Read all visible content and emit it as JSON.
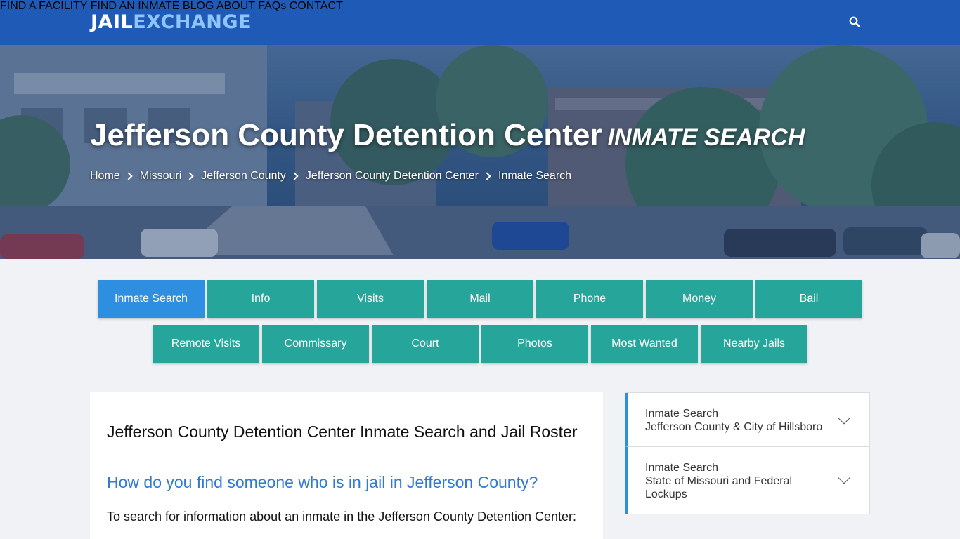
{
  "header": {
    "logo_part1": "JAIL",
    "logo_part2": "EXCHANGE",
    "nav": [
      "FIND A FACILITY",
      "FIND AN INMATE",
      "BLOG",
      "ABOUT",
      "FAQs",
      "CONTACT"
    ],
    "search_icon": "search-icon"
  },
  "hero": {
    "title": "Jefferson County Detention Center",
    "title_sub": "INMATE SEARCH",
    "breadcrumbs": [
      "Home",
      "Missouri",
      "Jefferson County",
      "Jefferson County Detention Center",
      "Inmate Search"
    ]
  },
  "tabs": {
    "row1": [
      "Inmate Search",
      "Info",
      "Visits",
      "Mail",
      "Phone",
      "Money",
      "Bail"
    ],
    "row2": [
      "Remote Visits",
      "Commissary",
      "Court",
      "Photos",
      "Most Wanted",
      "Nearby Jails"
    ],
    "active": "Inmate Search"
  },
  "main": {
    "heading": "Jefferson County Detention Center Inmate Search and Jail Roster",
    "subheading": "How do you find someone who is in jail in Jefferson County?",
    "intro": "To search for information about an inmate in the Jefferson County Detention Center:"
  },
  "sidebar": {
    "items": [
      {
        "line1": "Inmate Search",
        "line2": "Jefferson County & City of Hillsboro"
      },
      {
        "line1": "Inmate Search",
        "line2": "State of Missouri and Federal Lockups"
      }
    ]
  },
  "colors": {
    "header_bg": "#1f5ab6",
    "tab_bg": "#26a69a",
    "tab_active_bg": "#2e8ee0",
    "link_blue": "#2f7bd4",
    "logo_accent": "#8ec5ff"
  }
}
